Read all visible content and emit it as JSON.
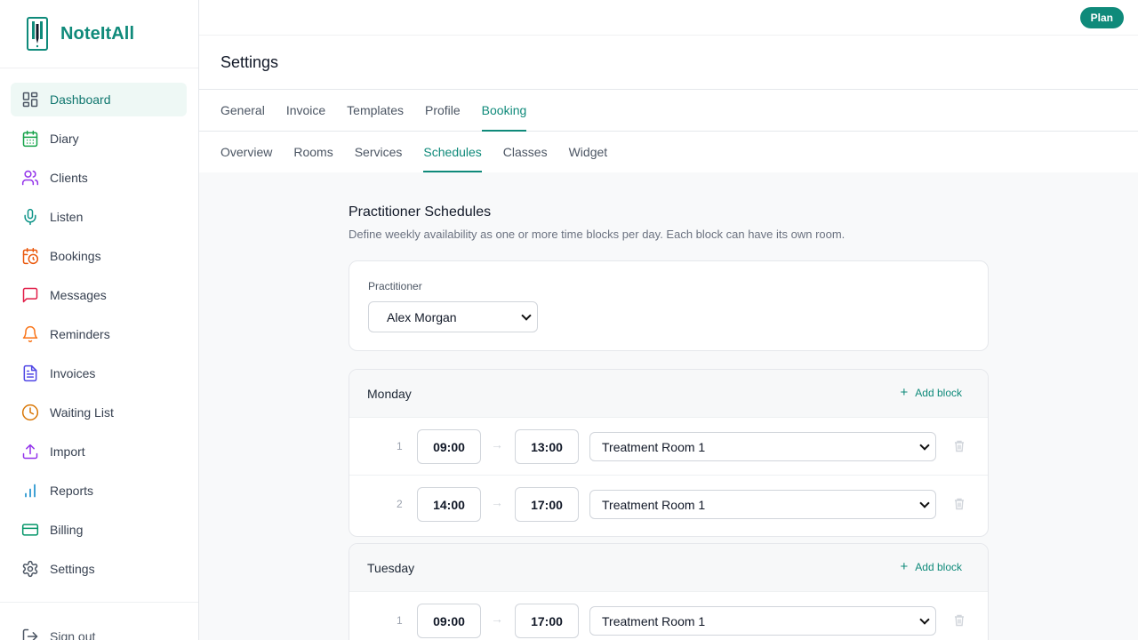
{
  "app": {
    "name": "NoteItAll",
    "plan_badge": "Plan"
  },
  "sidebar": {
    "items": [
      {
        "label": "Dashboard",
        "icon": "dashboard-icon",
        "color": "#4b5563",
        "active": true
      },
      {
        "label": "Diary",
        "icon": "calendar-icon",
        "color": "#16a34a"
      },
      {
        "label": "Clients",
        "icon": "users-icon",
        "color": "#9333ea"
      },
      {
        "label": "Listen",
        "icon": "microphone-icon",
        "color": "#0d9488"
      },
      {
        "label": "Bookings",
        "icon": "calendar-clock-icon",
        "color": "#ea580c"
      },
      {
        "label": "Messages",
        "icon": "message-icon",
        "color": "#e11d48"
      },
      {
        "label": "Reminders",
        "icon": "bell-icon",
        "color": "#f97316"
      },
      {
        "label": "Invoices",
        "icon": "document-icon",
        "color": "#4f46e5"
      },
      {
        "label": "Waiting List",
        "icon": "clock-icon",
        "color": "#d97706"
      },
      {
        "label": "Import",
        "icon": "upload-icon",
        "color": "#9333ea"
      },
      {
        "label": "Reports",
        "icon": "bar-chart-icon",
        "color": "#0284c7"
      },
      {
        "label": "Billing",
        "icon": "credit-card-icon",
        "color": "#059669"
      },
      {
        "label": "Settings",
        "icon": "gear-icon",
        "color": "#4b5563"
      }
    ],
    "signout_label": "Sign out"
  },
  "header": {
    "title": "Settings"
  },
  "tabs_primary": [
    "General",
    "Invoice",
    "Templates",
    "Profile",
    "Booking"
  ],
  "tabs_primary_active": "Booking",
  "tabs_secondary": [
    "Overview",
    "Rooms",
    "Services",
    "Schedules",
    "Classes",
    "Widget"
  ],
  "tabs_secondary_active": "Schedules",
  "section": {
    "title": "Practitioner Schedules",
    "description": "Define weekly availability as one or more time blocks per day. Each block can have its own room."
  },
  "practitioner": {
    "label": "Practitioner",
    "selected": "Alex Morgan"
  },
  "add_block_label": "Add block",
  "days": [
    {
      "name": "Monday",
      "blocks": [
        {
          "num": "1",
          "start": "09:00",
          "end": "13:00",
          "room": "Treatment Room 1"
        },
        {
          "num": "2",
          "start": "14:00",
          "end": "17:00",
          "room": "Treatment Room 1"
        }
      ]
    },
    {
      "name": "Tuesday",
      "blocks": [
        {
          "num": "1",
          "start": "09:00",
          "end": "17:00",
          "room": "Treatment Room 1"
        }
      ]
    }
  ],
  "colors": {
    "accent": "#0f8a7a",
    "active_nav_bg": "#eef8f5"
  }
}
